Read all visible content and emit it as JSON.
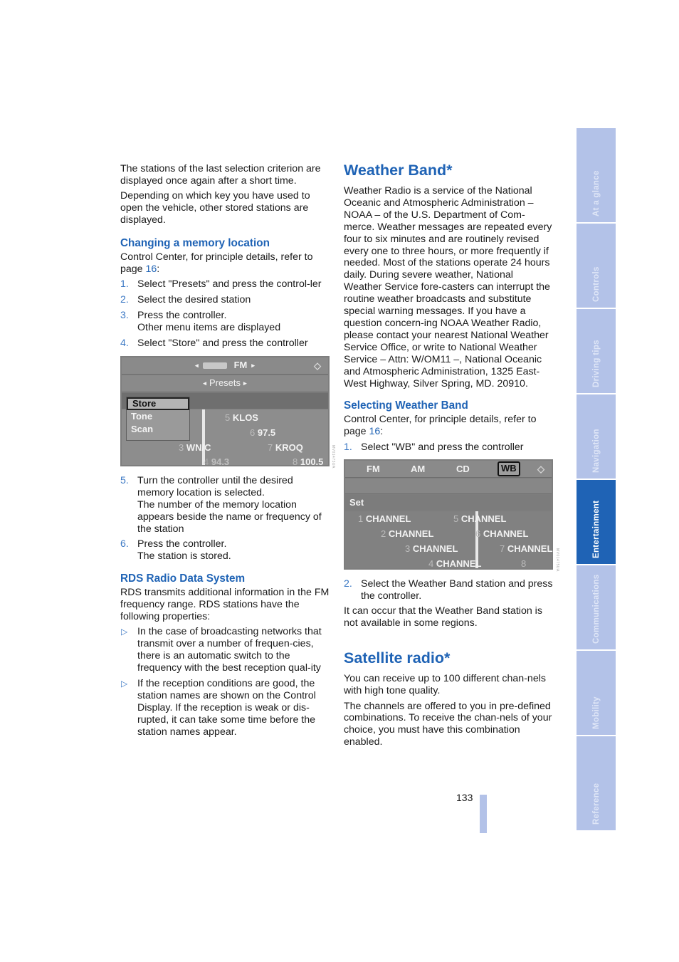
{
  "left_column": {
    "intro": [
      "The stations of the last selection criterion are displayed once again after a short time.",
      "Depending on which key you have used to open the vehicle, other stored stations are displayed."
    ],
    "memory_section": {
      "heading": "Changing a memory location",
      "ref_prefix": "Control Center, for principle details, refer to page ",
      "ref_page": "16",
      "ref_suffix": ":",
      "steps_before": [
        {
          "num": "1.",
          "text": "Select \"Presets\" and press the control-ler"
        },
        {
          "num": "2.",
          "text": "Select the desired station"
        },
        {
          "num": "3.",
          "text": "Press the controller.",
          "text2": "Other menu items are displayed"
        },
        {
          "num": "4.",
          "text": "Select \"Store\" and press the controller"
        }
      ],
      "steps_after": [
        {
          "num": "5.",
          "text": "Turn the controller until the desired memory location is selected.",
          "text2": "The number of the memory location appears beside the name or frequency of the station"
        },
        {
          "num": "6.",
          "text": "Press the controller.",
          "text2": "The station is stored."
        }
      ]
    },
    "presets_screen": {
      "band": "FM",
      "mode": "Presets",
      "menu": [
        "Store",
        "Tone",
        "Scan"
      ],
      "stations": [
        {
          "num": "5",
          "name": "KLOS"
        },
        {
          "num": "6",
          "name": "97.5"
        },
        {
          "num": "3",
          "name": "WN/C"
        },
        {
          "num": "7",
          "name": "KROQ"
        },
        {
          "num": "4",
          "name": "94.3"
        },
        {
          "num": "8",
          "name": "100.5"
        }
      ],
      "side_code": "MV01473UA"
    },
    "rds_section": {
      "heading": "RDS Radio Data System",
      "intro": "RDS transmits additional information in the FM frequency range. RDS stations have the following properties:",
      "bullets": [
        "In the case of broadcasting networks that transmit over a number of frequen-cies, there is an automatic switch to the frequency with the best reception qual-ity",
        "If the reception conditions are good, the station names are shown on the Control Display. If the reception is weak or dis-rupted, it can take some time before the station names appear."
      ]
    }
  },
  "right_column": {
    "weather_heading": "Weather Band*",
    "weather_body": "Weather Radio is a service of the National Oceanic and Atmospheric Administration – NOAA – of the U.S. Department of Com-merce. Weather messages are repeated every four to six minutes and are routinely revised every one to three hours, or more frequently if needed. Most of the stations operate 24 hours daily. During severe weather, National Weather Service fore-casters can interrupt the routine weather broadcasts and substitute special warning messages. If you have a question concern-ing NOAA Weather Radio, please contact your nearest National Weather Service Office, or write to National Weather Service – Attn: W/OM11 –, National Oceanic and Atmospheric Administration, 1325 East-West Highway, Silver Spring, MD. 20910.",
    "selecting": {
      "heading": "Selecting Weather Band",
      "ref_prefix": "Control Center, for principle details, refer to page ",
      "ref_page": "16",
      "ref_suffix": ":",
      "step1": {
        "num": "1.",
        "text": "Select \"WB\" and press the controller"
      },
      "step2": {
        "num": "2.",
        "text": "Select the Weather Band station and press the controller."
      },
      "note": "It can occur that the Weather Band station is not available in some regions."
    },
    "wb_screen": {
      "tabs": [
        "FM",
        "AM",
        "CD",
        "WB"
      ],
      "selected_tab": "WB",
      "set_label": "Set",
      "channels": [
        {
          "num": "1",
          "name": "CHANNEL"
        },
        {
          "num": "2",
          "name": "CHANNEL"
        },
        {
          "num": "3",
          "name": "CHANNEL"
        },
        {
          "num": "4",
          "name": "CHANNEL"
        },
        {
          "num": "5",
          "name": "CHANNEL"
        },
        {
          "num": "6",
          "name": "CHANNEL"
        },
        {
          "num": "7",
          "name": "CHANNEL"
        },
        {
          "num": "8",
          "name": ""
        }
      ],
      "side_code": "MV01475UA"
    },
    "satellite": {
      "heading": "Satellite radio*",
      "paras": [
        "You can receive up to 100 different chan-nels with high tone quality.",
        "The channels are offered to you in pre-defined combinations. To receive the chan-nels of your choice, you must have this combination enabled."
      ]
    }
  },
  "side_tabs": [
    {
      "label": "At a glance",
      "active": false
    },
    {
      "label": "Controls",
      "active": false
    },
    {
      "label": "Driving tips",
      "active": false
    },
    {
      "label": "Navigation",
      "active": false
    },
    {
      "label": "Entertainment",
      "active": true
    },
    {
      "label": "Communications",
      "active": false
    },
    {
      "label": "Mobility",
      "active": false
    },
    {
      "label": "Reference",
      "active": false
    }
  ],
  "page_number": "133",
  "colors": {
    "accent": "#1f63b5",
    "tab_inactive": "#b3c2e8",
    "tab_active": "#1f63b5"
  }
}
